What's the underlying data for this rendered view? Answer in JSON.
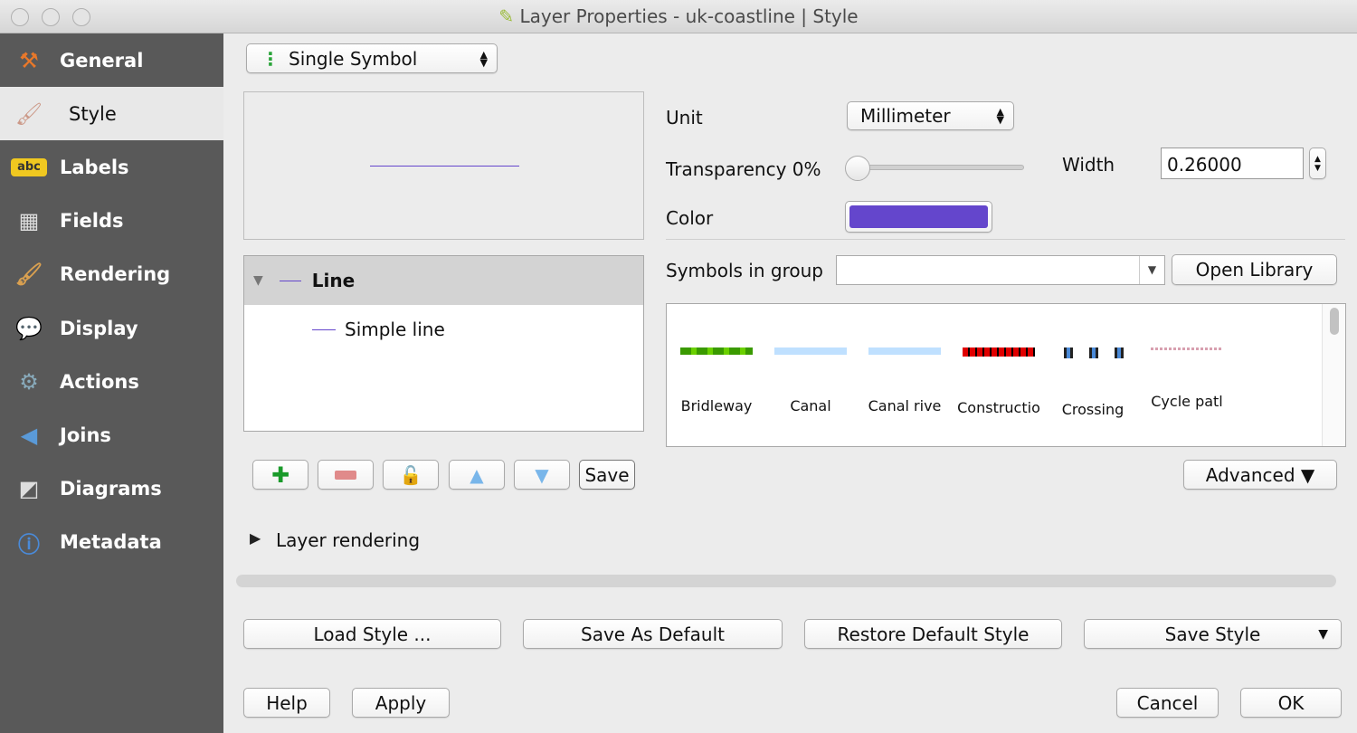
{
  "window": {
    "title": "Layer Properties - uk-coastline | Style"
  },
  "sidebar": {
    "items": [
      {
        "label": "General",
        "icon": "tools-icon",
        "selected": false
      },
      {
        "label": "Style",
        "icon": "paintbrush-icon",
        "selected": true
      },
      {
        "label": "Labels",
        "icon": "abc-label-icon",
        "selected": false
      },
      {
        "label": "Fields",
        "icon": "table-icon",
        "selected": false
      },
      {
        "label": "Rendering",
        "icon": "brush-icon",
        "selected": false
      },
      {
        "label": "Display",
        "icon": "speech-bubble-icon",
        "selected": false
      },
      {
        "label": "Actions",
        "icon": "gear-icon",
        "selected": false
      },
      {
        "label": "Joins",
        "icon": "join-arrow-icon",
        "selected": false
      },
      {
        "label": "Diagrams",
        "icon": "diagram-icon",
        "selected": false
      },
      {
        "label": "Metadata",
        "icon": "info-icon",
        "selected": false
      }
    ]
  },
  "renderer": {
    "selected": "Single Symbol"
  },
  "symbol_tree": {
    "root": "Line",
    "child": "Simple line"
  },
  "props": {
    "unit_label": "Unit",
    "unit_value": "Millimeter",
    "transparency_label": "Transparency 0%",
    "transparency_value": 0,
    "width_label": "Width",
    "width_value": "0.26000",
    "color_label": "Color",
    "color": "#6446cc"
  },
  "library": {
    "group_label": "Symbols in group",
    "group_value": "",
    "open_library": "Open Library",
    "advanced": "Advanced ▼",
    "symbols": [
      {
        "name": "Bridleway"
      },
      {
        "name": "Canal"
      },
      {
        "name": "Canal rive"
      },
      {
        "name": "Constructio"
      },
      {
        "name": "Crossing"
      },
      {
        "name": "Cycle patl"
      }
    ]
  },
  "tools": {
    "save": "Save"
  },
  "layer_rendering": "Layer rendering",
  "style_buttons": {
    "load": "Load Style ...",
    "save_default": "Save As Default",
    "restore": "Restore Default Style",
    "save_style": "Save Style"
  },
  "dialog": {
    "help": "Help",
    "apply": "Apply",
    "cancel": "Cancel",
    "ok": "OK"
  }
}
